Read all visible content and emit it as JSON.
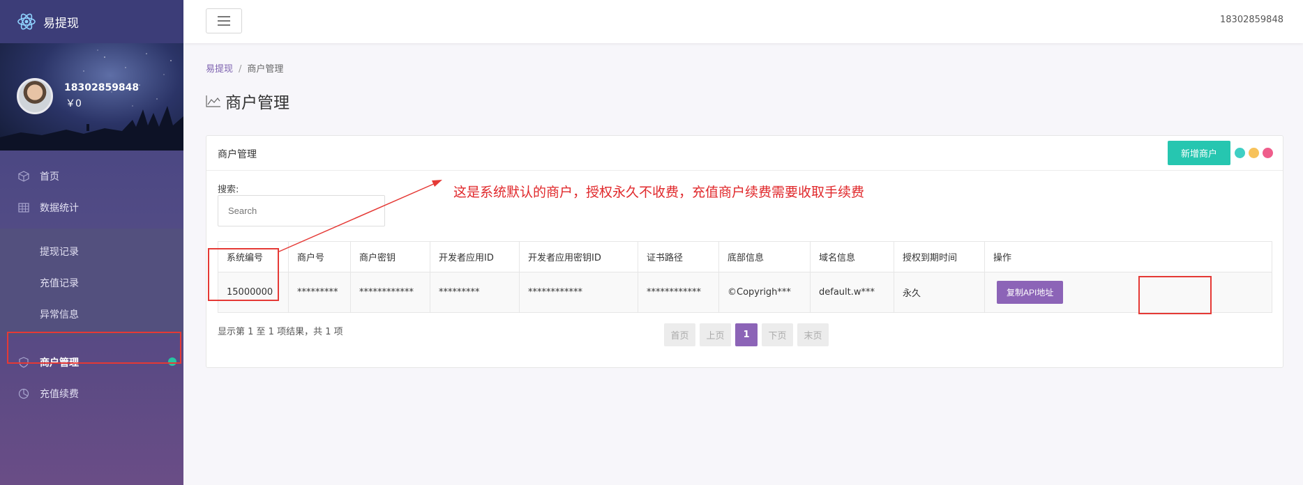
{
  "brand": {
    "name": "易提现"
  },
  "profile": {
    "username": "18302859848",
    "balance": "￥0"
  },
  "sidebar": {
    "items": [
      {
        "label": "首页",
        "icon": "cube-icon"
      },
      {
        "label": "数据统计",
        "icon": "table-icon"
      }
    ],
    "subitems": [
      {
        "label": "提现记录"
      },
      {
        "label": "充值记录"
      },
      {
        "label": "异常信息"
      }
    ],
    "bottom_items": [
      {
        "label": "商户管理",
        "icon": "shield-icon",
        "active": true
      },
      {
        "label": "充值续费",
        "icon": "pie-chart-icon"
      }
    ]
  },
  "topbar": {
    "user": "18302859848"
  },
  "breadcrumb": {
    "home": "易提现",
    "current": "商户管理"
  },
  "page": {
    "title": "商户管理"
  },
  "card": {
    "title": "商户管理",
    "add_button": "新增商户",
    "search_label": "搜索:",
    "search_placeholder": "Search",
    "annotation": "这是系统默认的商户，授权永久不收费，充值商户续费需要收取手续费"
  },
  "table": {
    "headers": [
      "系统编号",
      "商户号",
      "商户密钥",
      "开发者应用ID",
      "开发者应用密钥ID",
      "证书路径",
      "底部信息",
      "域名信息",
      "授权到期时间",
      "操作"
    ],
    "rows": [
      {
        "cells": [
          "15000000",
          "*********",
          "************",
          "*********",
          "************",
          "************",
          "©Copyrigh***",
          "default.w***",
          "永久"
        ],
        "action": "复制API地址"
      }
    ]
  },
  "footer": {
    "result_info": "显示第 1 至 1 项结果，共 1 项"
  },
  "pager": {
    "first": "首页",
    "prev": "上页",
    "current": "1",
    "next": "下页",
    "last": "末页"
  },
  "colors": {
    "accent": "#8c64b7",
    "teal": "#26c6b0",
    "annotation_red": "#e0282b"
  }
}
